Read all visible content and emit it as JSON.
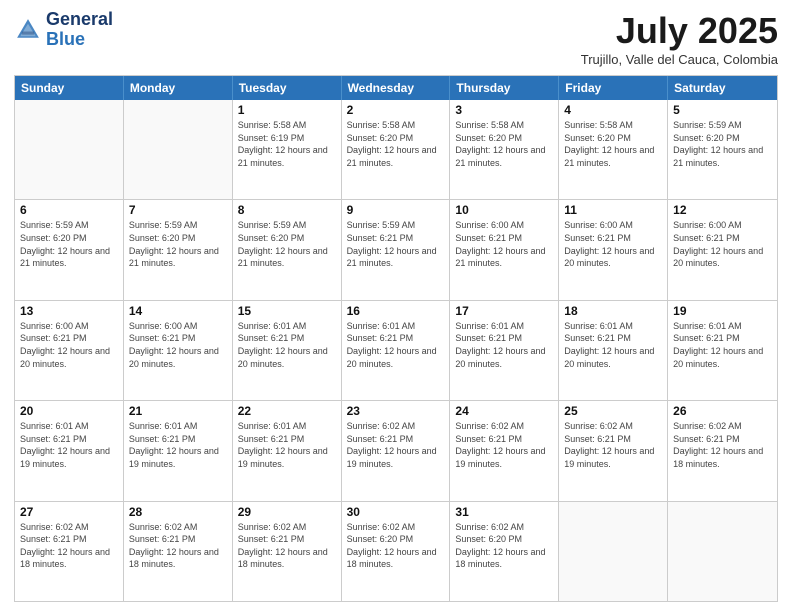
{
  "logo": {
    "line1": "General",
    "line2": "Blue"
  },
  "title": "July 2025",
  "location": "Trujillo, Valle del Cauca, Colombia",
  "days_of_week": [
    "Sunday",
    "Monday",
    "Tuesday",
    "Wednesday",
    "Thursday",
    "Friday",
    "Saturday"
  ],
  "weeks": [
    [
      {
        "day": "",
        "empty": true
      },
      {
        "day": "",
        "empty": true
      },
      {
        "day": "1",
        "info": "Sunrise: 5:58 AM\nSunset: 6:19 PM\nDaylight: 12 hours and 21 minutes."
      },
      {
        "day": "2",
        "info": "Sunrise: 5:58 AM\nSunset: 6:20 PM\nDaylight: 12 hours and 21 minutes."
      },
      {
        "day": "3",
        "info": "Sunrise: 5:58 AM\nSunset: 6:20 PM\nDaylight: 12 hours and 21 minutes."
      },
      {
        "day": "4",
        "info": "Sunrise: 5:58 AM\nSunset: 6:20 PM\nDaylight: 12 hours and 21 minutes."
      },
      {
        "day": "5",
        "info": "Sunrise: 5:59 AM\nSunset: 6:20 PM\nDaylight: 12 hours and 21 minutes."
      }
    ],
    [
      {
        "day": "6",
        "info": "Sunrise: 5:59 AM\nSunset: 6:20 PM\nDaylight: 12 hours and 21 minutes."
      },
      {
        "day": "7",
        "info": "Sunrise: 5:59 AM\nSunset: 6:20 PM\nDaylight: 12 hours and 21 minutes."
      },
      {
        "day": "8",
        "info": "Sunrise: 5:59 AM\nSunset: 6:20 PM\nDaylight: 12 hours and 21 minutes."
      },
      {
        "day": "9",
        "info": "Sunrise: 5:59 AM\nSunset: 6:21 PM\nDaylight: 12 hours and 21 minutes."
      },
      {
        "day": "10",
        "info": "Sunrise: 6:00 AM\nSunset: 6:21 PM\nDaylight: 12 hours and 21 minutes."
      },
      {
        "day": "11",
        "info": "Sunrise: 6:00 AM\nSunset: 6:21 PM\nDaylight: 12 hours and 20 minutes."
      },
      {
        "day": "12",
        "info": "Sunrise: 6:00 AM\nSunset: 6:21 PM\nDaylight: 12 hours and 20 minutes."
      }
    ],
    [
      {
        "day": "13",
        "info": "Sunrise: 6:00 AM\nSunset: 6:21 PM\nDaylight: 12 hours and 20 minutes."
      },
      {
        "day": "14",
        "info": "Sunrise: 6:00 AM\nSunset: 6:21 PM\nDaylight: 12 hours and 20 minutes."
      },
      {
        "day": "15",
        "info": "Sunrise: 6:01 AM\nSunset: 6:21 PM\nDaylight: 12 hours and 20 minutes."
      },
      {
        "day": "16",
        "info": "Sunrise: 6:01 AM\nSunset: 6:21 PM\nDaylight: 12 hours and 20 minutes."
      },
      {
        "day": "17",
        "info": "Sunrise: 6:01 AM\nSunset: 6:21 PM\nDaylight: 12 hours and 20 minutes."
      },
      {
        "day": "18",
        "info": "Sunrise: 6:01 AM\nSunset: 6:21 PM\nDaylight: 12 hours and 20 minutes."
      },
      {
        "day": "19",
        "info": "Sunrise: 6:01 AM\nSunset: 6:21 PM\nDaylight: 12 hours and 20 minutes."
      }
    ],
    [
      {
        "day": "20",
        "info": "Sunrise: 6:01 AM\nSunset: 6:21 PM\nDaylight: 12 hours and 19 minutes."
      },
      {
        "day": "21",
        "info": "Sunrise: 6:01 AM\nSunset: 6:21 PM\nDaylight: 12 hours and 19 minutes."
      },
      {
        "day": "22",
        "info": "Sunrise: 6:01 AM\nSunset: 6:21 PM\nDaylight: 12 hours and 19 minutes."
      },
      {
        "day": "23",
        "info": "Sunrise: 6:02 AM\nSunset: 6:21 PM\nDaylight: 12 hours and 19 minutes."
      },
      {
        "day": "24",
        "info": "Sunrise: 6:02 AM\nSunset: 6:21 PM\nDaylight: 12 hours and 19 minutes."
      },
      {
        "day": "25",
        "info": "Sunrise: 6:02 AM\nSunset: 6:21 PM\nDaylight: 12 hours and 19 minutes."
      },
      {
        "day": "26",
        "info": "Sunrise: 6:02 AM\nSunset: 6:21 PM\nDaylight: 12 hours and 18 minutes."
      }
    ],
    [
      {
        "day": "27",
        "info": "Sunrise: 6:02 AM\nSunset: 6:21 PM\nDaylight: 12 hours and 18 minutes."
      },
      {
        "day": "28",
        "info": "Sunrise: 6:02 AM\nSunset: 6:21 PM\nDaylight: 12 hours and 18 minutes."
      },
      {
        "day": "29",
        "info": "Sunrise: 6:02 AM\nSunset: 6:21 PM\nDaylight: 12 hours and 18 minutes."
      },
      {
        "day": "30",
        "info": "Sunrise: 6:02 AM\nSunset: 6:20 PM\nDaylight: 12 hours and 18 minutes."
      },
      {
        "day": "31",
        "info": "Sunrise: 6:02 AM\nSunset: 6:20 PM\nDaylight: 12 hours and 18 minutes."
      },
      {
        "day": "",
        "empty": true
      },
      {
        "day": "",
        "empty": true
      }
    ]
  ]
}
